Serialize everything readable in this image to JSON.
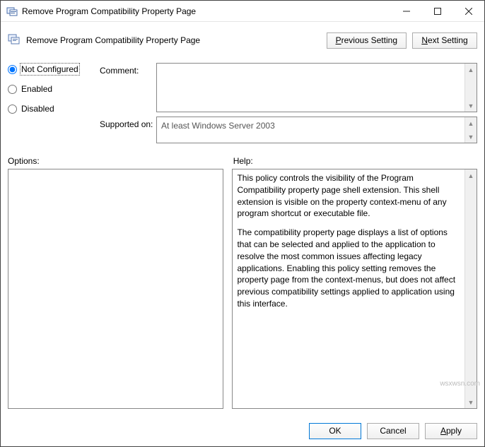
{
  "window": {
    "title": "Remove Program Compatibility Property Page"
  },
  "header": {
    "policy_title": "Remove Program Compatibility Property Page",
    "prev_pre": "P",
    "prev_post": "revious Setting",
    "next_pre": "N",
    "next_post": "ext Setting"
  },
  "radios": {
    "not_configured_pre": "Not ",
    "not_configured_u": "C",
    "not_configured_post": "onfigured",
    "enabled_u": "E",
    "enabled_post": "nabled",
    "disabled_u": "D",
    "disabled_post": "isabled"
  },
  "labels": {
    "comment": "Comment:",
    "supported_on": "Supported on:",
    "options": "Options:",
    "help": "Help:"
  },
  "fields": {
    "comment_value": "",
    "supported_value": "At least Windows Server 2003",
    "options_value": ""
  },
  "help": {
    "p1": "This policy controls the visibility of the Program Compatibility property page shell extension.  This shell extension is visible on the property context-menu of any program shortcut or executable file.",
    "p2": "The compatibility property page displays a list of options that can be selected and applied to the application to resolve the most common issues affecting legacy applications.  Enabling this policy setting removes the property page from the context-menus, but does not affect previous compatibility settings applied to application using this interface."
  },
  "footer": {
    "ok": "OK",
    "cancel": "Cancel",
    "apply_u": "A",
    "apply_post": "pply"
  },
  "watermark": "wsxwsn.com"
}
